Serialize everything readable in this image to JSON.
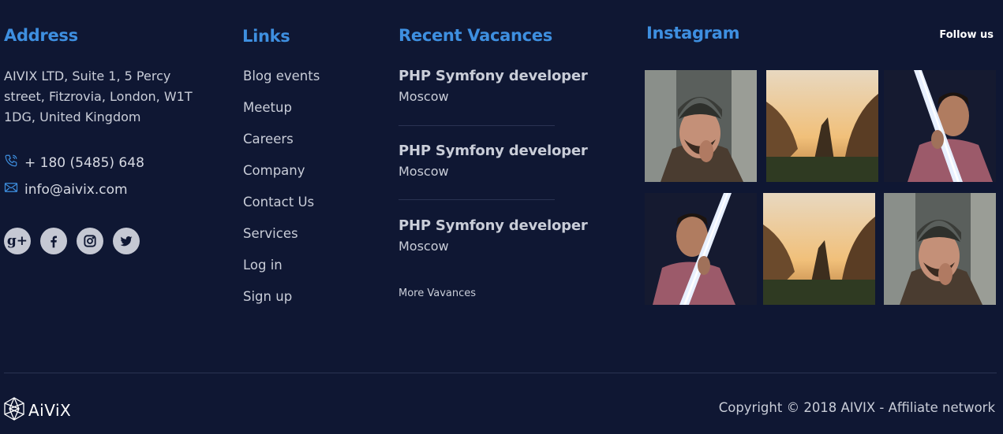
{
  "address": {
    "heading": "Address",
    "text": "AIVIX LTD, Suite 1, 5 Percy street, Fitzrovia, London, W1T 1DG, United Kingdom",
    "phone": "+ 180 (5485) 648",
    "email": "info@aivix.com",
    "social": [
      "google-plus-icon",
      "facebook-icon",
      "instagram-icon",
      "twitter-icon"
    ],
    "google_plus_label": "g+"
  },
  "links": {
    "heading": "Links",
    "items": [
      "Blog events",
      "Meetup",
      "Careers",
      "Company",
      "Contact Us",
      "Services",
      "Log in",
      "Sign up"
    ]
  },
  "vacancies": {
    "heading": "Recent Vacances",
    "items": [
      {
        "title": "PHP Symfony developer",
        "city": "Moscow"
      },
      {
        "title": "PHP Symfony developer",
        "city": "Moscow"
      },
      {
        "title": "PHP Symfony developer",
        "city": "Moscow"
      }
    ],
    "more_label": "More Vavances"
  },
  "instagram": {
    "heading": "Instagram",
    "follow_label": "Follow us",
    "photos": [
      "man-beanie-photo",
      "mountain-valley-photo",
      "man-lightsaber-photo",
      "man-lightsaber-photo",
      "mountain-valley-photo",
      "man-beanie-photo"
    ]
  },
  "footer": {
    "logo_text": "AiViX",
    "copyright": "Copyright © 2018 AIVIX - Affiliate network"
  },
  "colors": {
    "background": "#0f1733",
    "heading_accent": "#3e8fe0",
    "text": "#c9cdd8"
  }
}
